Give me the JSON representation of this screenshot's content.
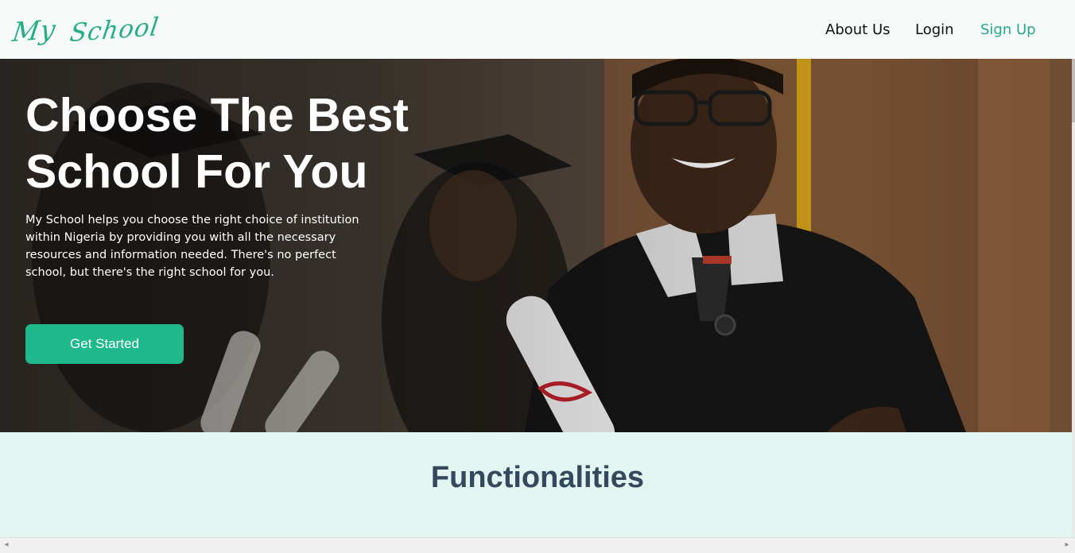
{
  "navbar": {
    "logo_word1": "My",
    "logo_word2": "School",
    "links": {
      "about": "About Us",
      "login": "Login",
      "signup": "Sign Up"
    }
  },
  "hero": {
    "title_line1": "Choose The Best",
    "title_line2": "School For You",
    "description": "My School helps you choose the right choice of institution within Nigeria by providing you with all the necessary resources and information needed. There's no perfect school, but there's the right school for you.",
    "cta_label": "Get Started"
  },
  "section": {
    "title": "Functionalities"
  },
  "scrollbar": {
    "left_arrow": "◂",
    "right_arrow": "▸"
  },
  "colors": {
    "brand": "#27ad86",
    "signup_link": "#25a98a",
    "cta": "#1fb98b",
    "section_bg": "#e2f5f1",
    "section_title": "#34495e"
  },
  "icons": [
    "scroll-left-arrow-icon",
    "scroll-right-arrow-icon"
  ]
}
